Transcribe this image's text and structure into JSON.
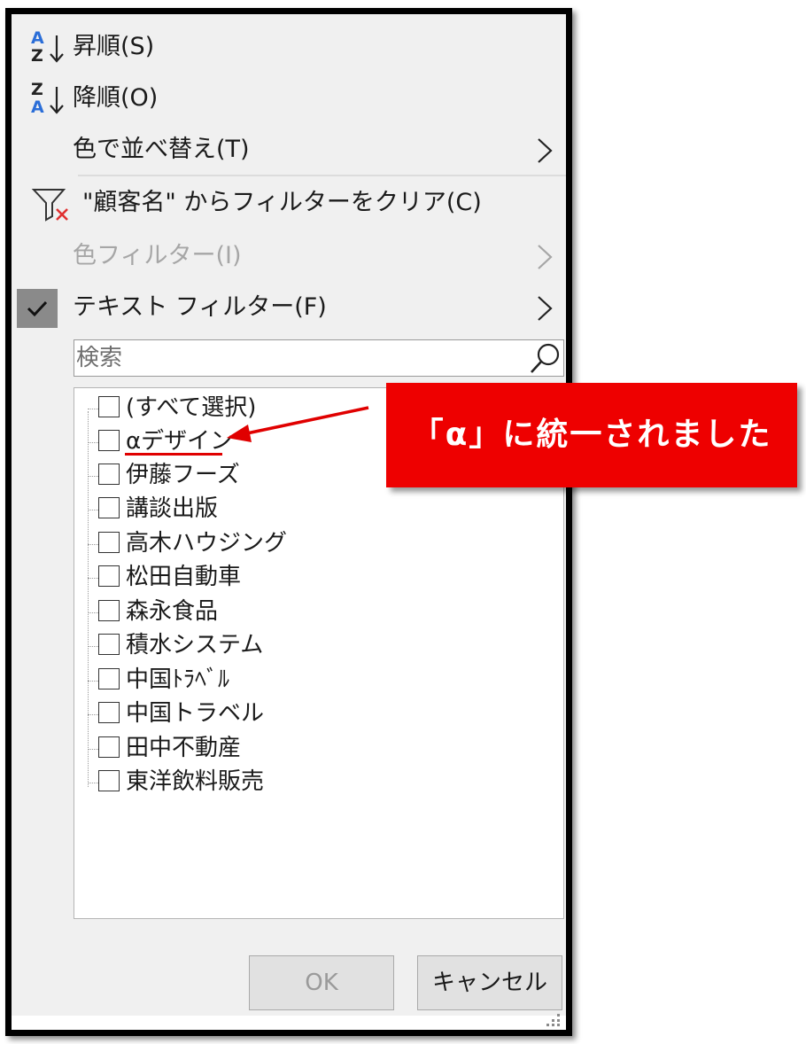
{
  "menu": {
    "sort_asc": {
      "label": "昇順(S)",
      "icon_top": "A",
      "icon_bottom": "Z"
    },
    "sort_desc": {
      "label": "降順(O)",
      "icon_top": "Z",
      "icon_bottom": "A"
    },
    "sort_by_color": {
      "label": "色で並べ替え(T)"
    },
    "clear_filter": {
      "label": "\"顧客名\" からフィルターをクリア(C)"
    },
    "color_filter": {
      "label": "色フィルター(I)",
      "disabled": true
    },
    "text_filter": {
      "label": "テキスト フィルター(F)",
      "checked": true
    }
  },
  "search": {
    "placeholder": "検索"
  },
  "list": {
    "items": [
      "(すべて選択)",
      "αデザイン",
      "伊藤フーズ",
      "講談出版",
      "高木ハウジング",
      "松田自動車",
      "森永食品",
      "積水システム",
      "中国ﾄﾗﾍﾞﾙ",
      "中国トラベル",
      "田中不動産",
      "東洋飲料販売"
    ]
  },
  "buttons": {
    "ok": "OK",
    "cancel": "キャンセル"
  },
  "annotation": {
    "text": "「α」に統一されました"
  },
  "colors": {
    "annotation_red": "#ee0000",
    "sort_icon_blue": "#2b6ed8",
    "disabled_text": "#a6a6a6"
  },
  "icons": [
    "sort-ascending-icon",
    "sort-descending-icon",
    "chevron-right-icon",
    "clear-filter-icon",
    "checkmark-icon",
    "search-icon",
    "resize-grip-icon"
  ]
}
